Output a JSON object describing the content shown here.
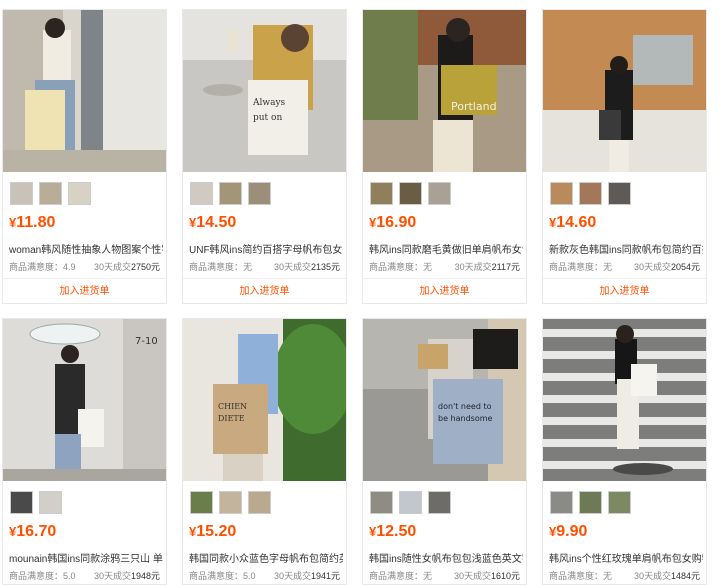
{
  "currency_symbol": "¥",
  "add_label": "加入进货单",
  "rating_label": "商品满意度：",
  "volume_label": "30天成交",
  "products": [
    {
      "price": "11.80",
      "title": "woman韩风随性抽象人物图案个性字...",
      "rating": "4.9",
      "volume": "2750元"
    },
    {
      "price": "14.50",
      "title": "UNF韩风ins简约百搭字母帆布包女手...",
      "rating": "无",
      "volume": "2135元"
    },
    {
      "price": "16.90",
      "title": "韩风ins同款磨毛黄做旧单肩帆布女包 ...",
      "rating": "无",
      "volume": "2117元"
    },
    {
      "price": "14.60",
      "title": "新款灰色韩国ins同款帆布包简约百搭...",
      "rating": "无",
      "volume": "2054元"
    },
    {
      "price": "16.70",
      "title": "mounain韩国ins同款涂鸦三只山 单肩...",
      "rating": "5.0",
      "volume": "1948元"
    },
    {
      "price": "15.20",
      "title": "韩国同款小众蓝色字母帆布包简约英...",
      "rating": "5.0",
      "volume": "1941元"
    },
    {
      "price": "12.50",
      "title": "韩国ins随性女帆布包包浅蓝色英文字...",
      "rating": "无",
      "volume": "1610元"
    },
    {
      "price": "9.90",
      "title": "韩风ins个性红玫瑰单肩帆布包女购物...",
      "rating": "无",
      "volume": "1484元"
    }
  ],
  "colors": {
    "price": "#ff5000",
    "border": "#e8e8e8"
  }
}
